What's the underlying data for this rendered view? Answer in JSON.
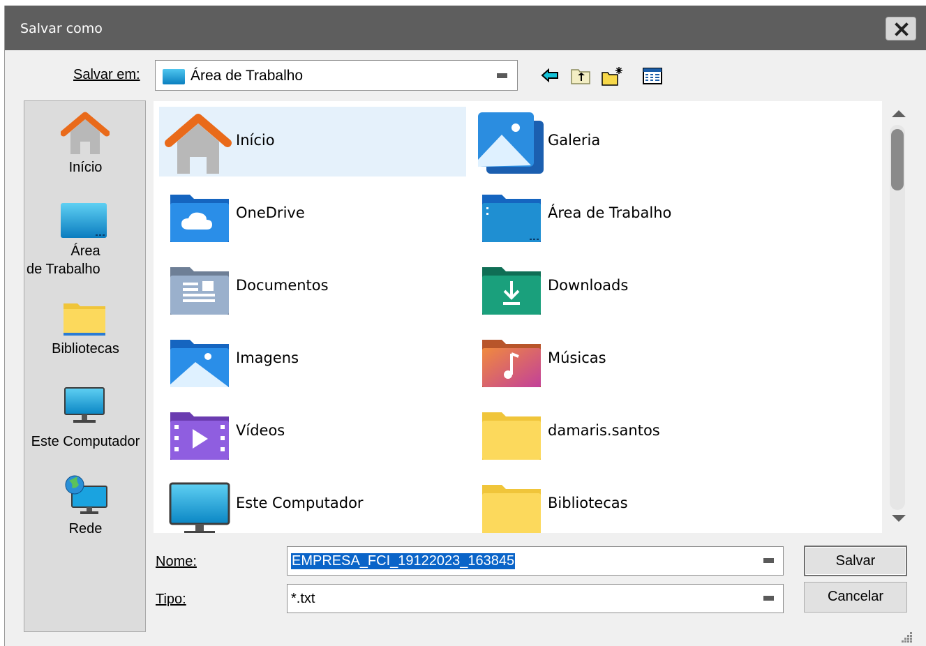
{
  "window": {
    "title": "Salvar como"
  },
  "toolbar": {
    "save_in_label": "Salvar em:",
    "location": "Área de Trabalho",
    "back_icon": "arrow-left-icon",
    "up_icon": "folder-up-icon",
    "new_folder_icon": "new-folder-icon",
    "view_icon": "view-menu-icon"
  },
  "places": [
    {
      "label": "Início",
      "icon": "home-icon"
    },
    {
      "label_line1": "Área",
      "label_line2": "de Trabalho",
      "icon": "desktop-icon"
    },
    {
      "label": "Bibliotecas",
      "icon": "libraries-icon"
    },
    {
      "label": "Este Computador",
      "icon": "computer-icon"
    },
    {
      "label": "Rede",
      "icon": "network-icon"
    }
  ],
  "files": [
    {
      "name": "Início",
      "icon": "home-icon",
      "selected": true
    },
    {
      "name": "Galeria",
      "icon": "gallery-icon"
    },
    {
      "name": "OneDrive",
      "icon": "onedrive-folder-icon"
    },
    {
      "name": "Área de Trabalho",
      "icon": "desktop-folder-icon"
    },
    {
      "name": "Documentos",
      "icon": "documents-folder-icon"
    },
    {
      "name": "Downloads",
      "icon": "downloads-folder-icon"
    },
    {
      "name": "Imagens",
      "icon": "pictures-folder-icon"
    },
    {
      "name": "Músicas",
      "icon": "music-folder-icon"
    },
    {
      "name": "Vídeos",
      "icon": "videos-folder-icon"
    },
    {
      "name": "damaris.santos",
      "icon": "folder-icon"
    },
    {
      "name": "Este Computador",
      "icon": "computer-icon"
    },
    {
      "name": "Bibliotecas",
      "icon": "folder-icon"
    }
  ],
  "form": {
    "name_label": "Nome:",
    "name_value": "EMPRESA_FCI_19122023_163845",
    "type_label": "Tipo:",
    "type_value": "*.txt"
  },
  "buttons": {
    "save": "Salvar",
    "cancel": "Cancelar"
  },
  "colors": {
    "titlebar": "#5e5e5e",
    "selection": "#0a64c8",
    "selected_item": "#e5f1fb"
  }
}
